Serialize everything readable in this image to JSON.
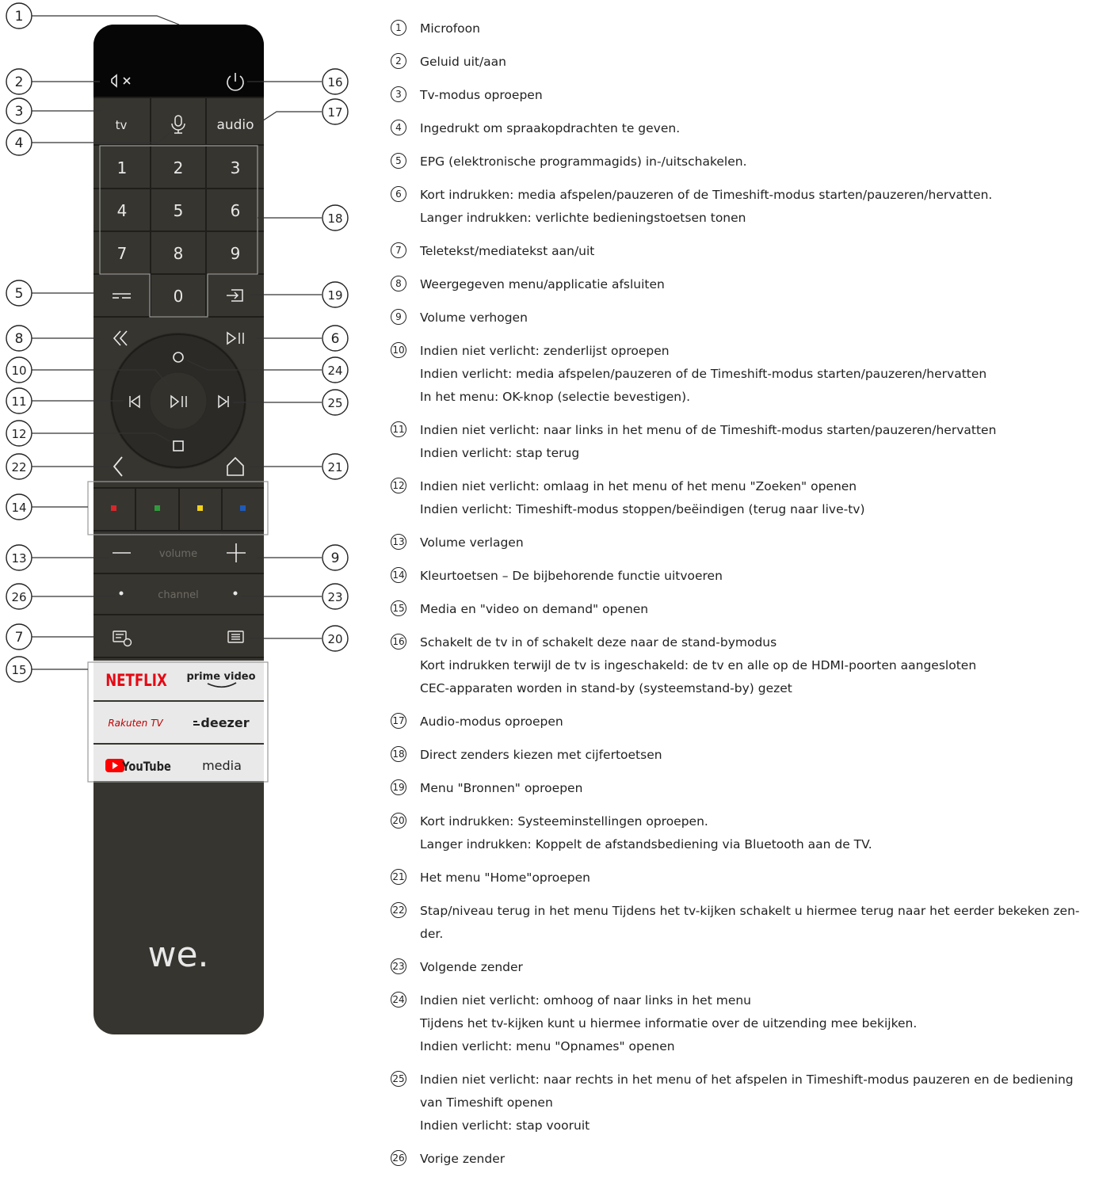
{
  "remote": {
    "buttons": {
      "tv": "tv",
      "audio": "audio",
      "digits": [
        "1",
        "2",
        "3",
        "4",
        "5",
        "6",
        "7",
        "8",
        "9",
        "0"
      ],
      "volume": "volume",
      "channel": "channel",
      "brand": "we.",
      "apps": [
        "NETFLIX",
        "prime video",
        "Rakuten TV",
        "deezer",
        "YouTube",
        "media"
      ]
    },
    "colors": {
      "body": "#37352f",
      "red": "#d7272b",
      "green": "#2f9a3c",
      "yellow": "#f2d21b",
      "blue": "#1f5ab8",
      "netflix": "#e50914",
      "youtube": "#ff0000",
      "rakuten": "#bf0000"
    }
  },
  "callouts": [
    {
      "n": "1"
    },
    {
      "n": "2"
    },
    {
      "n": "3"
    },
    {
      "n": "4"
    },
    {
      "n": "5"
    },
    {
      "n": "6"
    },
    {
      "n": "7"
    },
    {
      "n": "8"
    },
    {
      "n": "9"
    },
    {
      "n": "10"
    },
    {
      "n": "11"
    },
    {
      "n": "12"
    },
    {
      "n": "13"
    },
    {
      "n": "14"
    },
    {
      "n": "15"
    },
    {
      "n": "16"
    },
    {
      "n": "17"
    },
    {
      "n": "18"
    },
    {
      "n": "19"
    },
    {
      "n": "20"
    },
    {
      "n": "21"
    },
    {
      "n": "22"
    },
    {
      "n": "23"
    },
    {
      "n": "24"
    },
    {
      "n": "25"
    },
    {
      "n": "26"
    }
  ],
  "legend": [
    {
      "n": "1",
      "lines": [
        "Microfoon"
      ]
    },
    {
      "n": "2",
      "lines": [
        "Geluid uit/aan"
      ]
    },
    {
      "n": "3",
      "lines": [
        "Tv-modus oproepen"
      ]
    },
    {
      "n": "4",
      "lines": [
        "Ingedrukt om spraakopdrachten te geven."
      ]
    },
    {
      "n": "5",
      "lines": [
        "EPG (elektronische programmagids) in-/uitschakelen."
      ]
    },
    {
      "n": "6",
      "lines": [
        "Kort indrukken: media afspelen/pauzeren of de Timeshift-modus starten/pauzeren/hervatten.",
        "Langer indrukken: verlichte bedieningstoetsen tonen"
      ]
    },
    {
      "n": "7",
      "lines": [
        "Teletekst/mediatekst aan/uit"
      ]
    },
    {
      "n": "8",
      "lines": [
        "Weergegeven menu/applicatie afsluiten"
      ]
    },
    {
      "n": "9",
      "lines": [
        "Volume verhogen"
      ]
    },
    {
      "n": "10",
      "lines": [
        "Indien niet verlicht: zenderlijst oproepen",
        "Indien verlicht: media afspelen/pauzeren of de Timeshift-modus starten/pauzeren/hervatten",
        "In het menu: OK-knop (selectie bevestigen)."
      ]
    },
    {
      "n": "11",
      "lines": [
        "Indien niet verlicht: naar links in het menu of de Timeshift-modus starten/pauzeren/hervatten",
        "Indien verlicht: stap terug"
      ]
    },
    {
      "n": "12",
      "lines": [
        "Indien niet verlicht: omlaag in het menu of het menu \"Zoeken\" openen",
        "Indien verlicht: Timeshift-modus stoppen/beëindigen (terug naar live-tv)"
      ]
    },
    {
      "n": "13",
      "lines": [
        "Volume verlagen"
      ]
    },
    {
      "n": "14",
      "lines": [
        "Kleurtoetsen – De bijbehorende functie uitvoeren"
      ]
    },
    {
      "n": "15",
      "lines": [
        "Media en \"video on demand\" openen"
      ]
    },
    {
      "n": "16",
      "lines": [
        "Schakelt de tv in of schakelt deze naar de stand-bymodus",
        "Kort indrukken terwijl de tv is ingeschakeld: de tv en alle op de HDMI-poorten aangesloten",
        "CEC-apparaten worden in stand-by (systeemstand-by) gezet"
      ]
    },
    {
      "n": "17",
      "lines": [
        "Audio-modus oproepen"
      ]
    },
    {
      "n": "18",
      "lines": [
        "Direct zenders kiezen met cijfertoetsen"
      ]
    },
    {
      "n": "19",
      "lines": [
        "Menu \"Bronnen\" oproepen"
      ]
    },
    {
      "n": "20",
      "lines": [
        "Kort indrukken: Systeeminstellingen oproepen.",
        "Langer indrukken: Koppelt de afstandsbediening via Bluetooth aan de TV."
      ]
    },
    {
      "n": "21",
      "lines": [
        "Het menu \"Home\"oproepen"
      ]
    },
    {
      "n": "22",
      "lines": [
        "Stap/niveau terug in het menu Tijdens het tv-kijken schakelt u hiermee terug naar het eerder bekeken zen-",
        "der."
      ]
    },
    {
      "n": "23",
      "lines": [
        "Volgende zender"
      ]
    },
    {
      "n": "24",
      "lines": [
        "Indien niet verlicht: omhoog of naar links in het menu",
        "Tijdens het tv-kijken kunt u hiermee informatie over de uitzending mee bekijken.",
        "Indien verlicht: menu \"Opnames\" openen"
      ]
    },
    {
      "n": "25",
      "lines": [
        "Indien niet verlicht: naar rechts in het menu of het afspelen in Timeshift-modus pauzeren en de bediening",
        "van Timeshift openen",
        "Indien verlicht: stap vooruit"
      ]
    },
    {
      "n": "26",
      "lines": [
        "Vorige zender"
      ]
    }
  ]
}
